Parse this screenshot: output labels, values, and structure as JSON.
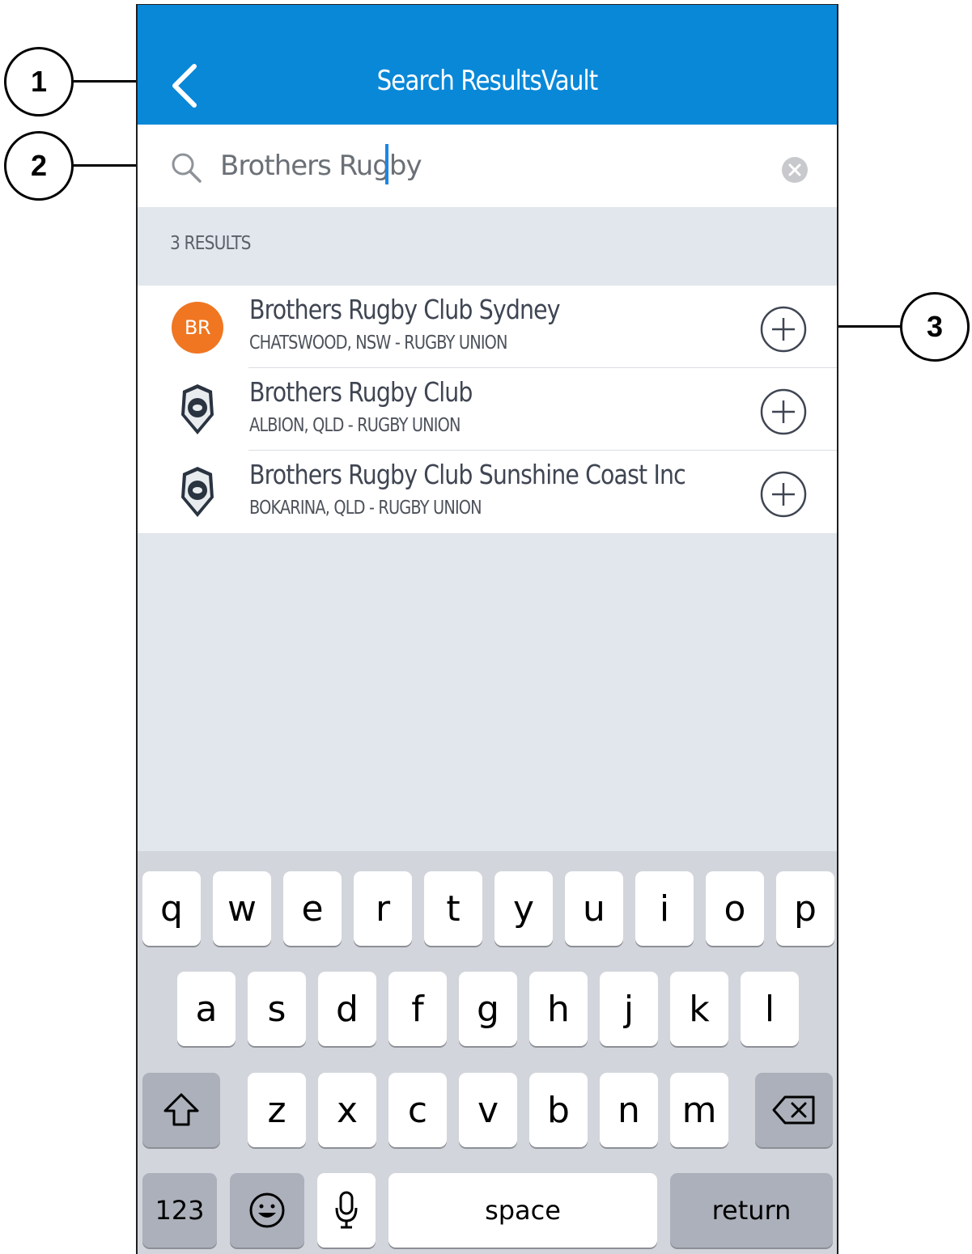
{
  "annotations": {
    "c1": "1",
    "c2": "2",
    "c3": "3"
  },
  "nav": {
    "title": "Search ResultsVault"
  },
  "search": {
    "value": "Brothers Rugby"
  },
  "results": {
    "count_label": "3 RESULTS",
    "items": [
      {
        "name": "Brothers Rugby Club Sydney",
        "meta": "CHATSWOOD, NSW -  RUGBY UNION",
        "avatar": "BR"
      },
      {
        "name": "Brothers Rugby Club",
        "meta": "ALBION, QLD -  RUGBY UNION"
      },
      {
        "name": "Brothers Rugby Club Sunshine Coast Inc",
        "meta": "BOKARINA, QLD -  RUGBY UNION"
      }
    ]
  },
  "keyboard": {
    "row1": [
      "q",
      "w",
      "e",
      "r",
      "t",
      "y",
      "u",
      "i",
      "o",
      "p"
    ],
    "row2": [
      "a",
      "s",
      "d",
      "f",
      "g",
      "h",
      "j",
      "k",
      "l"
    ],
    "row3": [
      "z",
      "x",
      "c",
      "v",
      "b",
      "n",
      "m"
    ],
    "numbers": "123",
    "space": "space",
    "return": "return"
  },
  "colors": {
    "navbar": "#0a88d8",
    "avatar": "#f07622",
    "caret": "#1a86e6"
  }
}
